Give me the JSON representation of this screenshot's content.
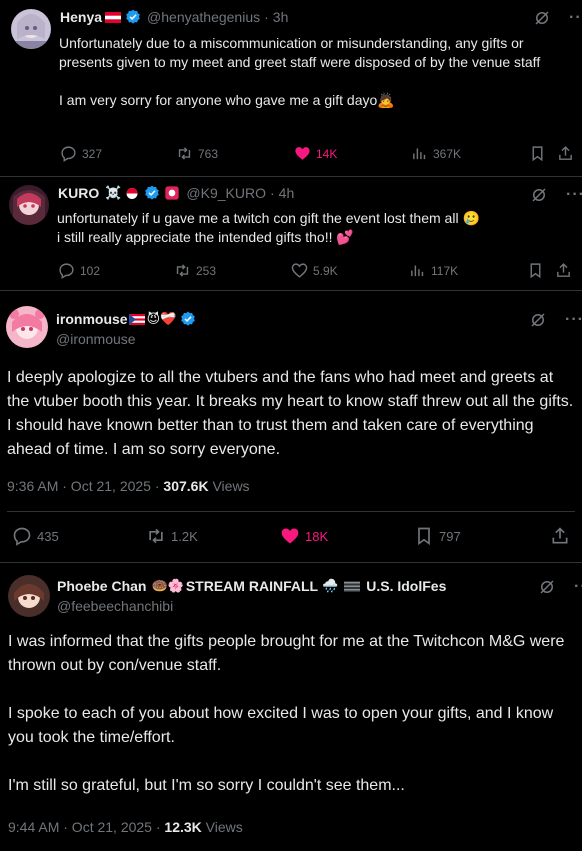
{
  "posts": [
    {
      "name": "Henya",
      "handle": "@henyathegenius",
      "time": "3h",
      "text": "Unfortunately due to a miscommunication or misunderstanding, any gifts or presents given to my meet and greet staff were disposed of by the venue staff\n\nI am very sorry for anyone who gave me a gift dayo🙇",
      "replies": "327",
      "reposts": "763",
      "likes": "14K",
      "views": "367K",
      "more": "···"
    },
    {
      "name": "KURO",
      "name_emojis": "☠️",
      "handle": "@K9_KURO",
      "time": "4h",
      "text": "unfortunately if u gave me a twitch con gift the event lost them all 🥲\ni still really appreciate the intended gifts tho!! 💕",
      "replies": "102",
      "reposts": "253",
      "likes": "5.9K",
      "views": "117K",
      "more": "···"
    },
    {
      "name": "ironmouse",
      "name_emojis": "😈❤️‍🩹",
      "handle": "@ironmouse",
      "text": "I deeply apologize to all the vtubers and the fans who had meet and greets at the vtuber booth this year. It breaks my heart to know staff threw out all the gifts. I should have known better than to trust them and taken care of everything ahead of time. I am so sorry everyone.",
      "timestamp": "9:36 AM · Oct 21, 2025 ·",
      "views_count": "307.6K",
      "views_label": "Views",
      "replies": "435",
      "reposts": "1.2K",
      "likes": "18K",
      "bookmarks": "797",
      "more": "···"
    },
    {
      "name": "Phoebe Chan",
      "name_emojis": "🍩🌸",
      "name_rest": "STREAM RAINFALL",
      "name_emojis2": "🌧️",
      "name_tail": "U.S. IdolFes",
      "handle": "@feebeechanchibi",
      "text": "I was informed that the gifts people brought for me at the Twitchcon M&G were thrown out by con/venue staff.\n\nI spoke to each of you about how excited I was to open your gifts, and I know you took the time/effort.\n\nI'm still so grateful, but I'm so sorry I couldn't see them...",
      "timestamp": "9:44 AM · Oct 21, 2025 ·",
      "views_count": "12.3K",
      "views_label": "Views",
      "more": "···"
    }
  ]
}
